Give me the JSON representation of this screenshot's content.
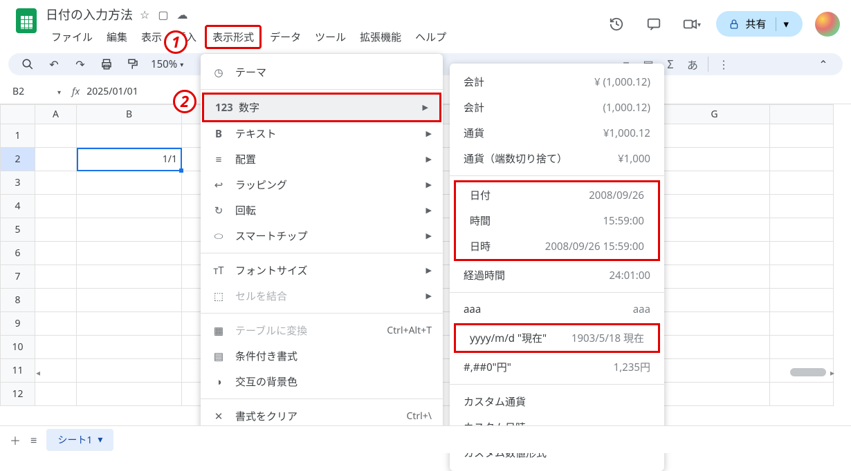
{
  "doc": {
    "title": "日付の入力方法"
  },
  "menubar": {
    "file": "ファイル",
    "edit": "編集",
    "view": "表示",
    "insert": "挿入",
    "format": "表示形式",
    "data": "データ",
    "tools": "ツール",
    "extensions": "拡張機能",
    "help": "ヘルプ"
  },
  "toolbar": {
    "zoom": "150%"
  },
  "share_label": "共有",
  "namebox": {
    "cell": "B2",
    "formula": "2025/01/01"
  },
  "columns": {
    "A": "A",
    "B": "B",
    "G": "G"
  },
  "rows": [
    "1",
    "2",
    "3",
    "4",
    "5",
    "6",
    "7",
    "8",
    "9",
    "10",
    "11",
    "12"
  ],
  "cell_b2": "1/1",
  "format_menu": {
    "theme": "テーマ",
    "number": "数字",
    "text": "テキスト",
    "align": "配置",
    "wrap": "ラッピング",
    "rotate": "回転",
    "smartchip": "スマートチップ",
    "fontsize": "フォントサイズ",
    "merge": "セルを結合",
    "table": "テーブルに変換",
    "table_shortcut": "Ctrl+Alt+T",
    "cond": "条件付き書式",
    "altcolor": "交互の背景色",
    "clear": "書式をクリア",
    "clear_shortcut": "Ctrl+\\"
  },
  "number_menu": [
    {
      "label": "会計",
      "example": "¥ (1,000.12)"
    },
    {
      "label": "会計",
      "example": "(1,000.12)"
    },
    {
      "label": "通貨",
      "example": "¥1,000.12"
    },
    {
      "label": "通貨（端数切り捨て）",
      "example": "¥1,000"
    }
  ],
  "number_menu_dates": [
    {
      "label": "日付",
      "example": "2008/09/26"
    },
    {
      "label": "時間",
      "example": "15:59:00"
    },
    {
      "label": "日時",
      "example": "2008/09/26 15:59:00"
    }
  ],
  "number_menu_post": [
    {
      "label": "経過時間",
      "example": "24:01:00"
    }
  ],
  "number_menu_custom1": [
    {
      "label": "aaa",
      "example": "aaa"
    }
  ],
  "number_menu_custom2": [
    {
      "label": "yyyy/m/d \"現在\"",
      "example": "1903/5/18 現在"
    }
  ],
  "number_menu_custom3": [
    {
      "label": "#,##0\"円\"",
      "example": "1,235円"
    }
  ],
  "number_menu_last": [
    {
      "label": "カスタム通貨"
    },
    {
      "label": "カスタム日時"
    },
    {
      "label": "カスタム数値形式"
    }
  ],
  "sheet_tab": "シート1",
  "callouts": {
    "one": "1",
    "two": "2"
  }
}
